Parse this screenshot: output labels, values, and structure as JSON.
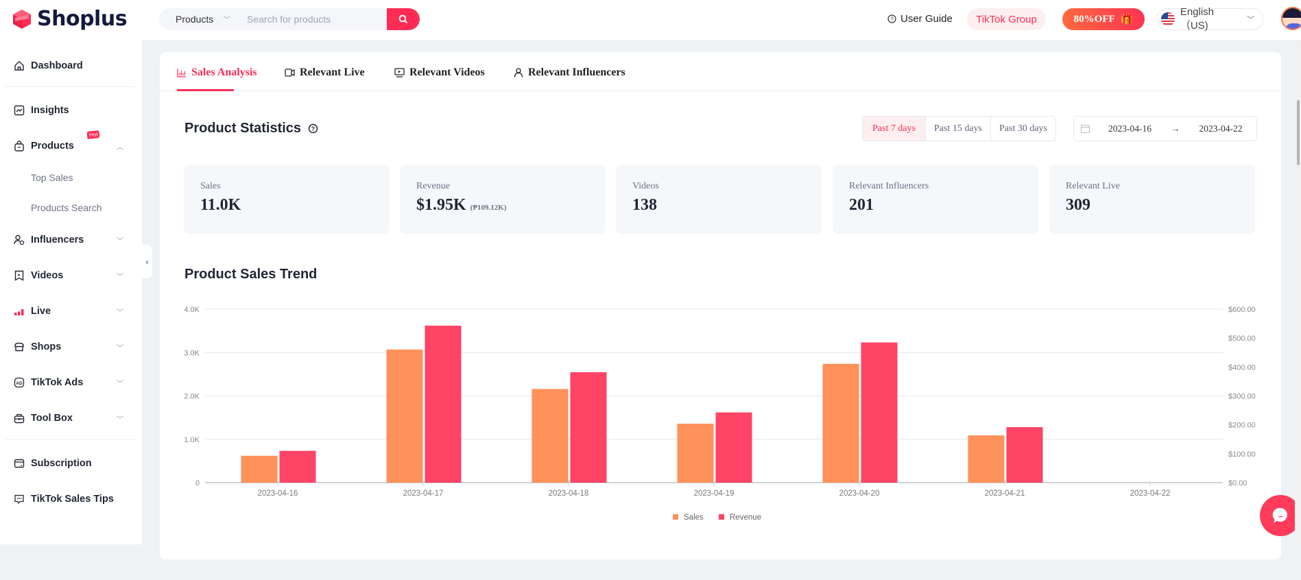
{
  "header": {
    "brand": "Shoplus",
    "search_category": "Products",
    "search_placeholder": "Search for products",
    "user_guide": "User Guide",
    "tiktok_group": "TikTok Group",
    "promo": "80%OFF",
    "language": "English（US)"
  },
  "sidebar": {
    "items": [
      {
        "label": "Dashboard",
        "icon": "home-icon"
      },
      {
        "label": "Insights",
        "icon": "chart-icon"
      },
      {
        "label": "Products",
        "icon": "bag-icon",
        "badge": "Hot",
        "expanded": true
      },
      {
        "label": "Influencers",
        "icon": "user-icon"
      },
      {
        "label": "Videos",
        "icon": "video-icon"
      },
      {
        "label": "Live",
        "icon": "live-icon"
      },
      {
        "label": "Shops",
        "icon": "shop-icon"
      },
      {
        "label": "TikTok Ads",
        "icon": "ad-icon"
      },
      {
        "label": "Tool Box",
        "icon": "toolbox-icon"
      },
      {
        "label": "Subscription",
        "icon": "card-icon"
      },
      {
        "label": "TikTok Sales Tips",
        "icon": "message-icon"
      }
    ],
    "sub_items": [
      "Top Sales",
      "Products Search"
    ]
  },
  "tabs": [
    {
      "label": "Sales Analysis",
      "active": true
    },
    {
      "label": "Relevant Live",
      "active": false
    },
    {
      "label": "Relevant Videos",
      "active": false
    },
    {
      "label": "Relevant Influencers",
      "active": false
    }
  ],
  "statistics": {
    "title": "Product Statistics",
    "periods": [
      "Past 7 days",
      "Past 15 days",
      "Past 30 days"
    ],
    "active_period": "Past 7 days",
    "date_start": "2023-04-16",
    "date_end": "2023-04-22",
    "date_separator": "→",
    "cards": [
      {
        "label": "Sales",
        "value": "11.0K"
      },
      {
        "label": "Revenue",
        "value": "$1.95K",
        "secondary": "(₱109.12K)"
      },
      {
        "label": "Videos",
        "value": "138"
      },
      {
        "label": "Relevant Influencers",
        "value": "201"
      },
      {
        "label": "Relevant Live",
        "value": "309"
      }
    ]
  },
  "trend_title": "Product Sales Trend",
  "chart_data": {
    "type": "bar",
    "title": "Product Sales Trend",
    "categories": [
      "2023-04-16",
      "2023-04-17",
      "2023-04-18",
      "2023-04-19",
      "2023-04-20",
      "2023-04-21",
      "2023-04-22"
    ],
    "series": [
      {
        "name": "Sales",
        "axis": "left",
        "color": "#ff915a",
        "values": [
          620,
          3070,
          2160,
          1360,
          2740,
          1090,
          0
        ]
      },
      {
        "name": "Revenue",
        "axis": "right",
        "color": "#ff4466",
        "values": [
          110,
          543,
          382,
          243,
          485,
          192,
          0
        ]
      }
    ],
    "left_axis": {
      "ylim": [
        0,
        4000
      ],
      "ticks": [
        "0",
        "1.0K",
        "2.0K",
        "3.0K",
        "4.0K"
      ]
    },
    "right_axis": {
      "ylim": [
        0,
        600
      ],
      "ticks": [
        "$0.00",
        "$100.00",
        "$200.00",
        "$300.00",
        "$400.00",
        "$500.00",
        "$600.00"
      ]
    },
    "grid": true,
    "legend": "bottom-center",
    "xlabel": "",
    "ylabel": ""
  }
}
